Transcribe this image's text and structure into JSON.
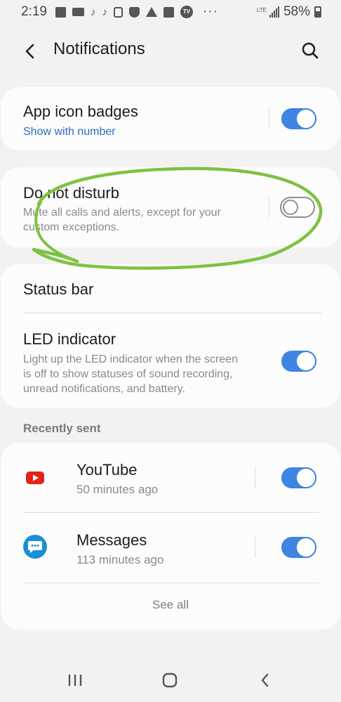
{
  "status_bar": {
    "time": "2:19",
    "more": "···",
    "network": "LTE",
    "battery": "58%"
  },
  "header": {
    "title": "Notifications",
    "back_icon": "back-arrow-icon",
    "search_icon": "search-icon"
  },
  "settings": {
    "app_icon_badges": {
      "title": "App icon badges",
      "subtitle": "Show with number",
      "enabled": true
    },
    "do_not_disturb": {
      "title": "Do not disturb",
      "subtitle_line1": "Mute all calls and alerts, except for your",
      "subtitle_line2": "custom exceptions.",
      "enabled": false
    },
    "status_bar": {
      "title": "Status bar"
    },
    "led_indicator": {
      "title": "LED indicator",
      "subtitle_line1": "Light up the LED indicator when the screen",
      "subtitle_line2": "is off to show statuses of sound recording,",
      "subtitle_line3": "unread notifications, and battery.",
      "enabled": true
    }
  },
  "recently_sent": {
    "label": "Recently sent",
    "apps": [
      {
        "name": "YouTube",
        "time": "50 minutes ago",
        "icon": "youtube-icon",
        "enabled": true
      },
      {
        "name": "Messages",
        "time": "113 minutes ago",
        "icon": "messages-icon",
        "enabled": true
      }
    ],
    "see_all": "See all"
  },
  "colors": {
    "accent": "#3e84e0",
    "link": "#2a6ebd",
    "annotation": "#7dc242",
    "background": "#f2f2f2",
    "card": "#fcfcfc"
  },
  "nav": {
    "recents_icon": "recents-icon",
    "home_icon": "home-icon",
    "back_icon": "nav-back-icon"
  }
}
